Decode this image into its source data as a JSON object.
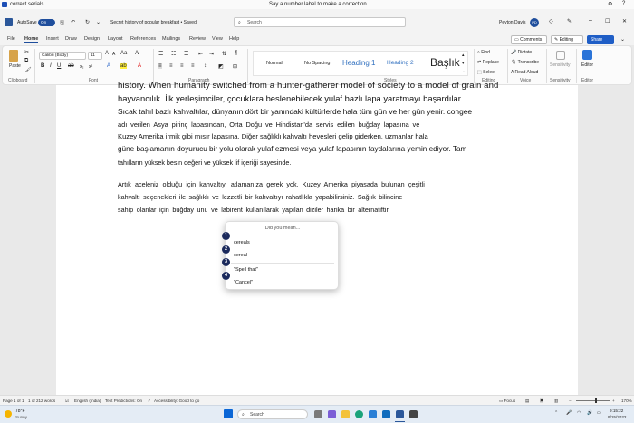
{
  "voice_title": "correct serials",
  "voice_prompt": "Say a number label to make a correction",
  "titlebar": {
    "autosave": "AutoSave",
    "toggle": "On",
    "doc_title": "Secret history of popular breakfast • Saved",
    "search": "Search",
    "user": "Peyton Davis",
    "initials": "PD"
  },
  "tabs": [
    "File",
    "Home",
    "Insert",
    "Draw",
    "Design",
    "Layout",
    "References",
    "Mailings",
    "Review",
    "View",
    "Help"
  ],
  "header_buttons": {
    "comments": "Comments",
    "editing": "Editing",
    "share": "Share"
  },
  "ribbon": {
    "paste": "Paste",
    "clipboard": "Clipboard",
    "font_name": "Calibri (Body)",
    "font_size": "11",
    "font_group": "Font",
    "paragraph": "Paragraph",
    "styles": [
      "Normal",
      "No Spacing",
      "Heading 1",
      "Heading 2",
      "Başlık"
    ],
    "styles_group": "Styles",
    "find": "Find",
    "replace": "Replace",
    "select": "Select",
    "editing_group": "Editing",
    "dictate": "Dictate",
    "transcribe": "Transcribe",
    "read_aloud": "Read Aloud",
    "voice_group": "Voice",
    "sensitivity": "Sensitivity",
    "sensitivity_group": "Sensitivity",
    "editor": "Editor",
    "editor_group": "Editor"
  },
  "document": {
    "p1": [
      "history. When humanity switched from a hunter-gatherer model of society to a model of grain and",
      "hayvancılık. İlk yerleşimciler, çocuklara beslenebilecek yulaf bazlı lapa yaratmayı başardılar.",
      "Sıcak tahıl bazlı kahvaltılar, dünyanın dört bir yanındaki kültürlerde hala tüm gün ve her gün yenir. congee",
      "adı verilen Asya pirinç lapasından, Orta Doğu ve Hindistan'da servis edilen buğday lapasına ve",
      "Kuzey Amerika irmik gibi mısır lapasına. Diğer sağlıklı kahvaltı hevesleri gelip giderken, uzmanlar hala",
      "güne başlamanın doyurucu bir yolu olarak yulaf ezmesi veya yulaf lapasının faydalarına yemin ediyor. Tam",
      "tahılların yüksek besin değeri ve yüksek lif içeriği sayesinde."
    ],
    "p2": [
      "Artık aceleniz olduğu için kahvaltıyı atlamanıza gerek yok. Kuzey Amerika piyasada bulunan çeşitli",
      "kahvaltı seçenekleri ile sağlıklı ve lezzetli bir kahvaltıyı rahatlıkla yapabilirsiniz. Sağlık bilincine",
      "sahip olanlar için buğday unu ve labirent kullanılarak yapılan diziler harika bir alternatiftir"
    ]
  },
  "popup": {
    "title": "Did you mean...",
    "items": [
      {
        "num": "1",
        "text": "cereals"
      },
      {
        "num": "2",
        "text": "cereal"
      },
      {
        "num": "3",
        "text": "\"Spell that\""
      },
      {
        "num": "4",
        "text": "\"Cancel\""
      }
    ]
  },
  "status": {
    "page": "Page 1 of 1",
    "words": "1 of 212 words",
    "lang": "English (India)",
    "predictions": "Text Predictions: On",
    "accessibility": "Accessibility: Good to go",
    "focus": "Focus",
    "zoom": "170%"
  },
  "taskbar": {
    "temp": "78°F",
    "weather": "Sunny",
    "search": "Search",
    "time": "9:15:22",
    "date": "9/15/2022"
  }
}
